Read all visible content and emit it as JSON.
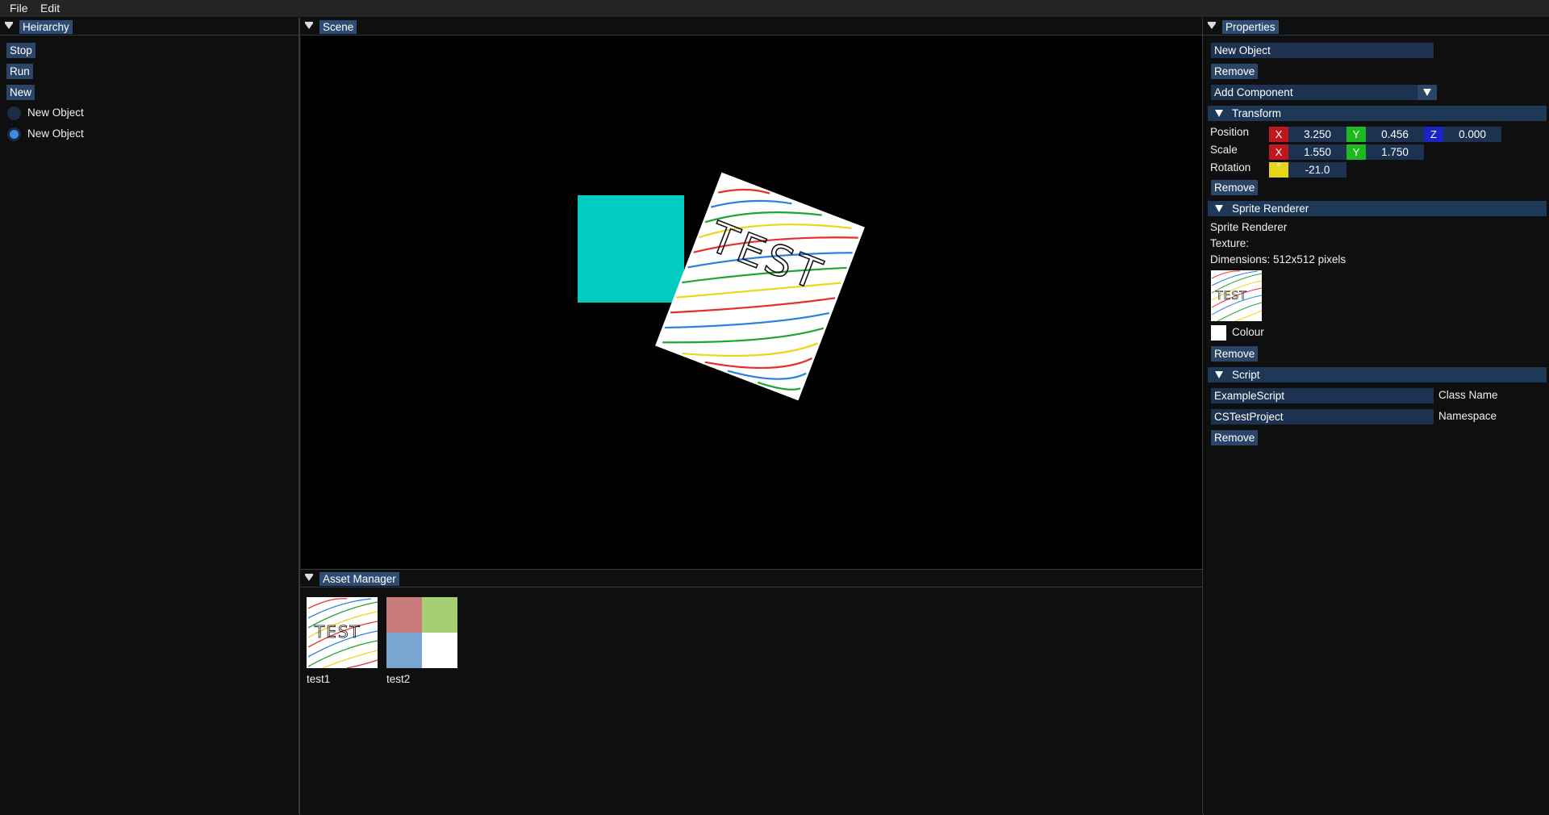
{
  "menu": {
    "file": "File",
    "edit": "Edit"
  },
  "hierarchy": {
    "title": "Heirarchy",
    "stop_label": "Stop",
    "run_label": "Run",
    "new_label": "New",
    "items": [
      {
        "label": "New Object",
        "selected": false
      },
      {
        "label": "New Object",
        "selected": true
      }
    ]
  },
  "scene": {
    "title": "Scene",
    "square_color": "#00ccc2",
    "sprite_text": "TEST"
  },
  "assets": {
    "title": "Asset Manager",
    "items": [
      {
        "label": "test1",
        "thumb_text": "TEST"
      },
      {
        "label": "test2"
      }
    ],
    "test2_colors": [
      "#c97b7b",
      "#a6cf72",
      "#78a6d1",
      "#ffffff"
    ]
  },
  "properties": {
    "title": "Properties",
    "name_value": "New Object",
    "remove_label": "Remove",
    "add_component_label": "Add Component",
    "transform": {
      "header": "Transform",
      "position_label": "Position",
      "scale_label": "Scale",
      "rotation_label": "Rotation",
      "x_label": "X",
      "y_label": "Y",
      "z_label": "Z",
      "rot_axis_label": "°",
      "position": {
        "x": "3.250",
        "y": "0.456",
        "z": "0.000"
      },
      "scale": {
        "x": "1.550",
        "y": "1.750"
      },
      "rotation": "-21.0",
      "remove_label": "Remove",
      "colors": {
        "x": "#c0171c",
        "y": "#1fb81f",
        "z": "#1a23c8",
        "rot": "#e6d617"
      }
    },
    "sprite_renderer": {
      "header": "Sprite Renderer",
      "name": "Sprite Renderer",
      "texture_label": "Texture:",
      "dimensions": "Dimensions: 512x512 pixels",
      "thumb_text": "TEST",
      "colour_label": "Colour",
      "remove_label": "Remove"
    },
    "script": {
      "header": "Script",
      "class_value": "ExampleScript",
      "class_label": "Class Name",
      "namespace_value": "CSTestProject",
      "namespace_label": "Namespace",
      "remove_label": "Remove"
    }
  }
}
